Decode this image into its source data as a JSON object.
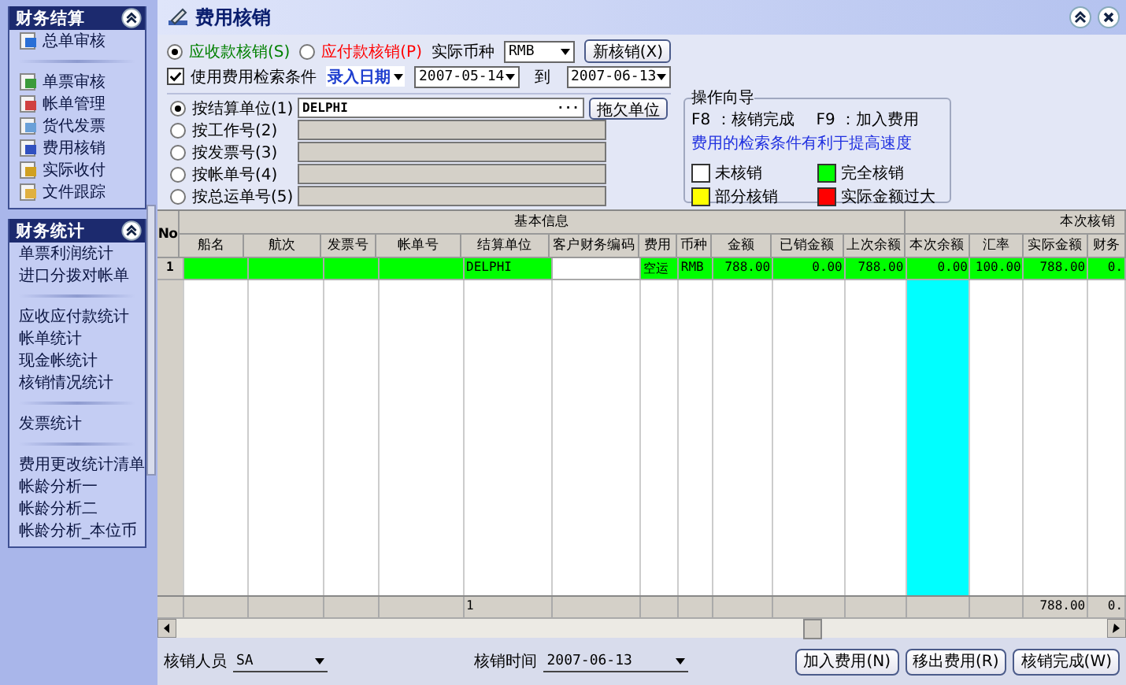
{
  "sidebar": {
    "panels": [
      {
        "title": "财务结算",
        "expanded": true,
        "kind": "icons",
        "groups": [
          [
            "总单审核"
          ],
          [
            "单票审核",
            "帐单管理",
            "货代发票",
            "费用核销",
            "实际收付",
            "文件跟踪"
          ]
        ]
      },
      {
        "title": "财务统计",
        "expanded": true,
        "kind": "plain",
        "groups": [
          [
            "单票利润统计",
            "进口分拨对帐单"
          ],
          [
            "应收应付款统计",
            "帐单统计",
            "现金帐统计",
            "核销情况统计"
          ],
          [
            "发票统计"
          ],
          [
            "费用更改统计清单",
            "帐龄分析一",
            "帐龄分析二",
            "帐龄分析_本位币"
          ]
        ]
      }
    ]
  },
  "window": {
    "title": "费用核销"
  },
  "mode_options": [
    {
      "label": "应收款核销(S)",
      "selected": true,
      "color": "#008000"
    },
    {
      "label": "应付款核销(P)",
      "selected": false,
      "color": "#ff0000"
    }
  ],
  "currency": {
    "label": "实际币种",
    "value": "RMB"
  },
  "new_button": "新核销(X)",
  "use_filter": {
    "label": "使用费用检索条件",
    "checked": true
  },
  "date_field": {
    "value": "录入日期",
    "from": "2007-05-14",
    "to_label": "到",
    "to": "2007-06-13"
  },
  "search_options": [
    {
      "label": "按结算单位(1)",
      "selected": true,
      "value": "DELPHI",
      "disabled": false
    },
    {
      "label": "按工作号(2)",
      "selected": false,
      "disabled": true
    },
    {
      "label": "按发票号(3)",
      "selected": false,
      "disabled": true
    },
    {
      "label": "按帐单号(4)",
      "selected": false,
      "disabled": true
    },
    {
      "label": "按总运单号(5)",
      "selected": false,
      "disabled": true
    }
  ],
  "browse_button": "···",
  "debt_button": "拖欠单位",
  "guide": {
    "title": "操作向导",
    "shortcuts": [
      "F8 ：核销完成",
      "F9 ：加入费用"
    ],
    "hint": "费用的检索条件有利于提高速度",
    "legend": [
      {
        "label": "未核销",
        "color": "#ffffff"
      },
      {
        "label": "完全核销",
        "color": "#00ff00"
      },
      {
        "label": "部分核销",
        "color": "#ffff00"
      },
      {
        "label": "实际金额过大",
        "color": "#ff0000"
      }
    ]
  },
  "table": {
    "index_header": "No",
    "groups": [
      {
        "label": "基本信息",
        "columns": [
          {
            "label": "船名",
            "kind": "text"
          },
          {
            "label": "航次",
            "kind": "text"
          },
          {
            "label": "发票号",
            "kind": "text"
          },
          {
            "label": "帐单号",
            "kind": "text"
          },
          {
            "label": "结算单位",
            "kind": "text",
            "total": "1"
          },
          {
            "label": "客户财务编码",
            "kind": "text"
          },
          {
            "label": "费用",
            "kind": "text"
          },
          {
            "label": "币种",
            "kind": "text"
          },
          {
            "label": "金额",
            "kind": "number"
          },
          {
            "label": "已销金额",
            "kind": "number"
          },
          {
            "label": "上次余额",
            "kind": "number"
          }
        ]
      },
      {
        "label": "本次核销",
        "columns": [
          {
            "label": "本次余额",
            "kind": "number",
            "highlighted": true
          },
          {
            "label": "汇率",
            "kind": "number"
          },
          {
            "label": "实际金额",
            "kind": "number",
            "total": "788.00"
          },
          {
            "label": "财务",
            "kind": "number",
            "total": "0."
          }
        ]
      }
    ],
    "rows": [
      {
        "number": "1",
        "color": "#00ff00",
        "cells": [
          {
            "filled": true
          },
          {
            "filled": true
          },
          {
            "filled": true
          },
          {
            "filled": true
          },
          {
            "text": "DELPHI",
            "filled": true
          },
          {
            "filled": false
          },
          {
            "text": "空运",
            "filled": true
          },
          {
            "text": "RMB",
            "filled": true
          },
          {
            "text": "788.00",
            "filled": true
          },
          {
            "text": "0.00",
            "filled": true
          },
          {
            "text": "788.00",
            "filled": true
          },
          {
            "text": "0.00",
            "filled": true
          },
          {
            "text": "100.00",
            "filled": true
          },
          {
            "text": "788.00",
            "filled": true
          },
          {
            "text": "0.",
            "filled": true
          }
        ]
      }
    ]
  },
  "footer": {
    "operator_label": "核销人员",
    "operator": "SA",
    "time_label": "核销时间",
    "time": "2007-06-13",
    "buttons": [
      "加入费用(N)",
      "移出费用(R)",
      "核销完成(W)"
    ]
  }
}
